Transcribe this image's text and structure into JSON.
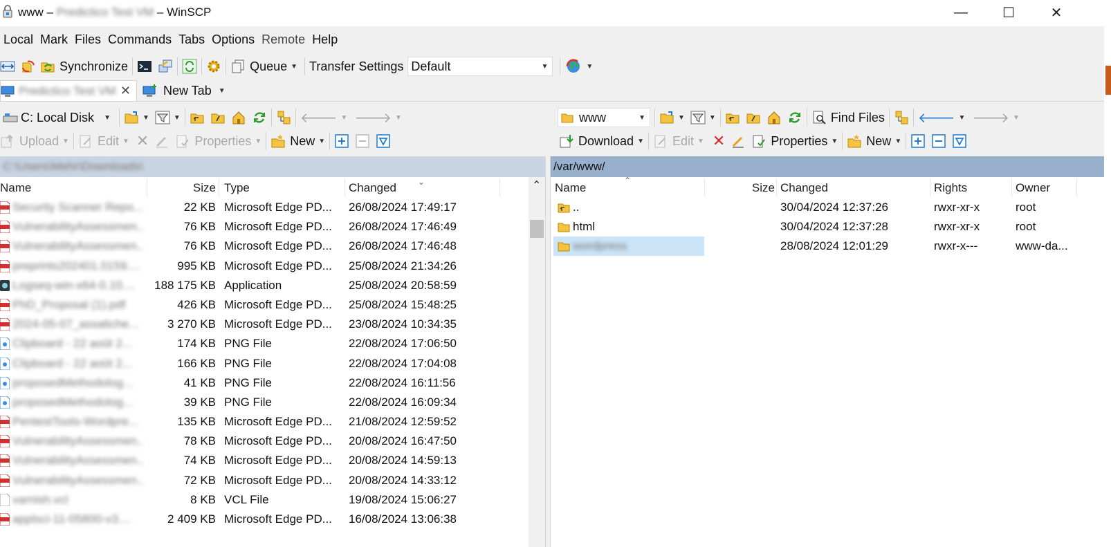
{
  "window": {
    "title": "www – Predictico Test VM – WinSCP",
    "controls": {
      "minimize": "—",
      "maximize": "☐",
      "close": "✕"
    }
  },
  "menu": [
    "Local",
    "Mark",
    "Files",
    "Commands",
    "Tabs",
    "Options",
    "Remote",
    "Help"
  ],
  "toolbar": {
    "synchronize": "Synchronize",
    "queue": "Queue",
    "transfer_settings_label": "Transfer Settings",
    "transfer_settings_value": "Default"
  },
  "tabs": {
    "session_tab": "Predictico Test VM",
    "new_tab": "New Tab"
  },
  "local": {
    "drive": "C: Local Disk",
    "actions": {
      "upload": "Upload",
      "edit": "Edit",
      "properties": "Properties",
      "new": "New"
    },
    "path": "C:\\Users\\Mehr\\Downloads\\",
    "columns": {
      "name": "Name",
      "size": "Size",
      "type": "Type",
      "changed": "Changed"
    },
    "files": [
      {
        "name": "Security Scanner Repo...",
        "size": "22 KB",
        "type": "Microsoft Edge PD...",
        "changed": "26/08/2024 17:49:17",
        "icon": "pdf-icon"
      },
      {
        "name": "VulnerabilityAssessmen...",
        "size": "76 KB",
        "type": "Microsoft Edge PD...",
        "changed": "26/08/2024 17:46:49",
        "icon": "pdf-icon"
      },
      {
        "name": "VulnerabilityAssessmen...",
        "size": "76 KB",
        "type": "Microsoft Edge PD...",
        "changed": "26/08/2024 17:46:48",
        "icon": "pdf-icon"
      },
      {
        "name": "preprints202401.0159....",
        "size": "995 KB",
        "type": "Microsoft Edge PD...",
        "changed": "25/08/2024 21:34:26",
        "icon": "pdf-icon"
      },
      {
        "name": "Logseq-win-x64-0.10....",
        "size": "188 175 KB",
        "type": "Application",
        "changed": "25/08/2024 20:58:59",
        "icon": "app-icon"
      },
      {
        "name": "PhD_Proposal (1).pdf",
        "size": "426 KB",
        "type": "Microsoft Edge PD...",
        "changed": "25/08/2024 15:48:25",
        "icon": "pdf-icon"
      },
      {
        "name": "2024-05-07_assatiche...",
        "size": "3 270 KB",
        "type": "Microsoft Edge PD...",
        "changed": "23/08/2024 10:34:35",
        "icon": "pdf-icon"
      },
      {
        "name": "Clipboard - 22 août 2...",
        "size": "174 KB",
        "type": "PNG File",
        "changed": "22/08/2024 17:06:50",
        "icon": "png-icon"
      },
      {
        "name": "Clipboard - 22 août 2...",
        "size": "166 KB",
        "type": "PNG File",
        "changed": "22/08/2024 17:04:08",
        "icon": "png-icon"
      },
      {
        "name": "proposedMethodolog...",
        "size": "41 KB",
        "type": "PNG File",
        "changed": "22/08/2024 16:11:56",
        "icon": "png-icon"
      },
      {
        "name": "proposedMethodolog...",
        "size": "39 KB",
        "type": "PNG File",
        "changed": "22/08/2024 16:09:34",
        "icon": "png-icon"
      },
      {
        "name": "PentestTools-Wordpre...",
        "size": "135 KB",
        "type": "Microsoft Edge PD...",
        "changed": "21/08/2024 12:59:52",
        "icon": "pdf-icon"
      },
      {
        "name": "VulnerabilityAssessmen...",
        "size": "78 KB",
        "type": "Microsoft Edge PD...",
        "changed": "20/08/2024 16:47:50",
        "icon": "pdf-icon"
      },
      {
        "name": "VulnerabilityAssessmen...",
        "size": "74 KB",
        "type": "Microsoft Edge PD...",
        "changed": "20/08/2024 14:59:13",
        "icon": "pdf-icon"
      },
      {
        "name": "VulnerabilityAssessmen...",
        "size": "72 KB",
        "type": "Microsoft Edge PD...",
        "changed": "20/08/2024 14:33:12",
        "icon": "pdf-icon"
      },
      {
        "name": "varnish.vcl",
        "size": "8 KB",
        "type": "VCL File",
        "changed": "19/08/2024 15:06:27",
        "icon": "file-icon"
      },
      {
        "name": "applsci-11-05800-v3....",
        "size": "2 409 KB",
        "type": "Microsoft Edge PD...",
        "changed": "16/08/2024 13:06:38",
        "icon": "pdf-icon"
      }
    ]
  },
  "remote": {
    "folder": "www",
    "find_files": "Find Files",
    "actions": {
      "download": "Download",
      "edit": "Edit",
      "properties": "Properties",
      "new": "New"
    },
    "path": "/var/www/",
    "columns": {
      "name": "Name",
      "size": "Size",
      "changed": "Changed",
      "rights": "Rights",
      "owner": "Owner"
    },
    "files": [
      {
        "name": "..",
        "size": "",
        "changed": "30/04/2024 12:37:26",
        "rights": "rwxr-xr-x",
        "owner": "root",
        "icon": "parent-folder-icon"
      },
      {
        "name": "html",
        "size": "",
        "changed": "30/04/2024 12:37:28",
        "rights": "rwxr-xr-x",
        "owner": "root",
        "icon": "folder-icon"
      },
      {
        "name": "wordpress",
        "size": "",
        "changed": "28/08/2024 12:01:29",
        "rights": "rwxr-x---",
        "owner": "www-da...",
        "icon": "folder-icon",
        "selected": true
      }
    ]
  },
  "colors": {
    "path_local": "#c9d5e3",
    "path_remote": "#98b0cc",
    "selection": "#cce4f7",
    "accent_blue": "#1e7bd6",
    "delete_red": "#d9282e",
    "folder_yellow": "#f5c342"
  }
}
